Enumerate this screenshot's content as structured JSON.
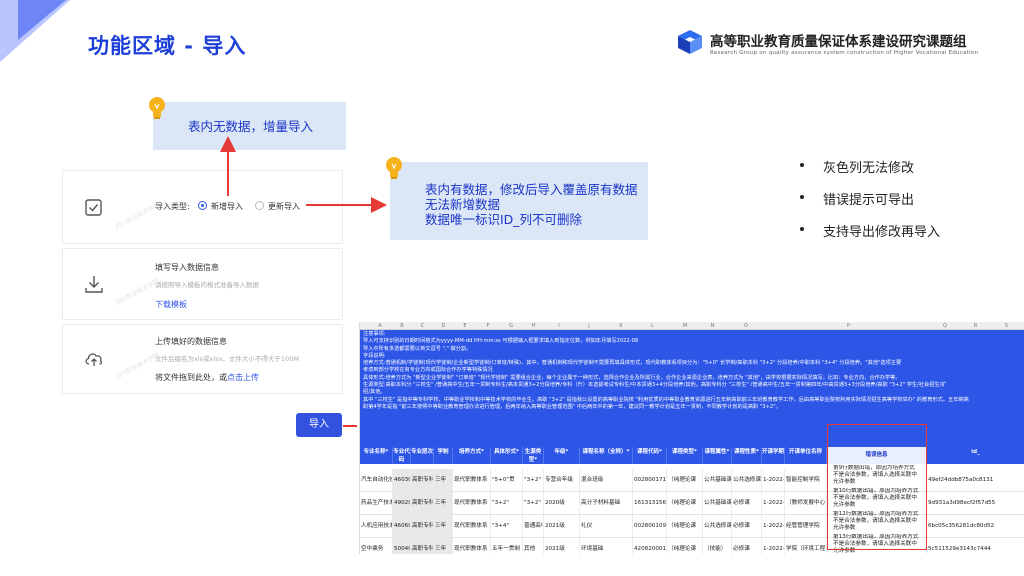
{
  "header": {
    "title": "功能区域 - 导入",
    "org_cn": "高等职业教育质量保证体系建设研究课题组",
    "org_en": "Research Group on quality assurance system construction of Higher Vocational Education"
  },
  "callouts": {
    "c1": "表内无数据，增量导入",
    "c2_lines": [
      "表内有数据，修改后导入覆盖原有数据",
      "无法新增数据",
      "数据唯一标识ID_列不可删除"
    ]
  },
  "panel": {
    "import_type_label": "导入类型:",
    "option_new": "新增导入",
    "option_update": "更新导入",
    "fill_title": "填写导入数据信息",
    "fill_desc": "请按照导入模板的格式准备导入数据",
    "download_link": "下载模板",
    "upload_title": "上传填好的数据信息",
    "upload_desc": "文件后缀名为xls或xlsx，文件大小不得大于100M",
    "drag_text": "将文件拖到此处，或",
    "click_upload": "点击上传",
    "import_button": "导入"
  },
  "watermark": "四川职业技术学院",
  "bullets": [
    "灰色列无法修改",
    "错误提示可导出",
    "支持导出修改再导入"
  ],
  "sheet": {
    "columns": [
      "",
      "A",
      "B",
      "C",
      "D",
      "E",
      "F",
      "G",
      "H",
      "I",
      "J",
      "K",
      "L",
      "M",
      "N",
      "O",
      "P",
      "Q",
      "R",
      "S"
    ],
    "notes": [
      "注意事项:",
      "导入可支持识别的日期时间格式为yyyy-MM-dd HH:mm:ss 可根据输入框要求填入到指定位数，例如年月填写2022-08",
      "导入中所有多选都需要以英文逗号 \",\" 做分割。",
      "字段说明:",
      "培养方式:普通机制/学徒制(现代学徒制/企业新型学徒制/订单班/特殊)，其中，普通机制和现代学徒制不需要再填具体形式，现代职教体系项目分为：\"5+0\" 长学制/高职本科 \"3+2\" 分段培养/中职本科 \"3+4\" 分段培养。\"其他\"选项主要",
      "考虑到部分学校在有专业方向或国际合作办学等特殊情况",
      "具体形式:培养方式为 \"新型企业学徒制\" \"订单班\" \"现代学徒制\" 需要组合企业，每个企业属于一种形式，选择合作企业及所属行业，合作企业来源企业表，培养方式为 \"其他\"，由学校根据实际情况填写，比如：专业方向，合作办学等。",
      "生源类型:高职本科分 \"三校生\" /普通高中生/五年一贯制专科生/高本贯通3+2分段培养/专科（升）本选拔考试专科生/中本贯通3+4分段培养/其他。高职专科分 \"三校生\" /普通高中生/五年一贯制第四年/中高贯通3+3分段培养/高职 \"3+2\" 学生/社会招生/扩",
      "招/其他。",
      "其中 \"三校生\" 是指中等专科学校、中等职业学校和中等技术学校的毕业生。高职 \"3+2\" 是指我公设置的高等职业院校 \"利用优质的中等职业教育资源进行五年制高职前三年的教育教学工作，后由高等职业院校利用实际情况招生高等学校举办\" 的教育形式。五年制高",
      "职第4学年是指 \"前三年按照中等职业教育管理办法进行管理，后两年纳入高等职业管理范围\" 中后两年中的第一年，建议同一教学计划是五年一贯制，不同教学计划的是高职 \"3+2\"。"
    ],
    "headers": [
      "专业名称*",
      "专业代码",
      "专业层次",
      "学制",
      "培养方式*",
      "具体形式*",
      "生源类型*",
      "年级*",
      "课程名称（全称）*",
      "课程代码*",
      "课程类型*",
      "课程属性*",
      "课程性质*",
      "开课学期",
      "开课单位名称",
      "错误信息",
      "id_"
    ],
    "rows": [
      [
        "汽车自动化技",
        "460306",
        "高职专科",
        "三年",
        "现代职教体系",
        "\"5+0\"贯",
        "\"3+2\"",
        "专营合年级",
        "混合班级",
        "002800171",
        "（纯理论课",
        "公共基础课",
        "公共选修课",
        "1-2022-1",
        "智能控制学院",
        "",
        "49ef24ddb875a0c8131"
      ],
      [
        "药品生产技术",
        "490201",
        "高职专科",
        "三年",
        "现代职教体系",
        "\"3+2\"",
        "\"3+2\"",
        "2020级",
        "高分子材料基础",
        "161313156",
        "（纯理论课",
        "公共基础课",
        "必修课",
        "1-2022-1",
        "（教师发展中心",
        "",
        "9d931a3d98ecf2f57d55"
      ],
      [
        "人机应用技术",
        "460609",
        "高职专科",
        "三年",
        "现代职教体系",
        "\"3+4\"",
        "普通高中生",
        "2021级",
        "礼仪",
        "002800109",
        "（纯理论课",
        "公共选修课",
        "必修课",
        "1-2022-1",
        "经管管理学院",
        "",
        "6bc05c356281dc80d52"
      ],
      [
        "空中乘务",
        "500405",
        "高职专科",
        "三年",
        "现代职教体系",
        "五年一贯制",
        "其他",
        "2021级",
        "环境基础",
        "420820001",
        "（纯理论课",
        "（技能）",
        "必修课",
        "1-2022-1",
        "学院（环境工程",
        "",
        "5c511529e3143c7444"
      ]
    ],
    "errors": [
      [
        "第9行数据出错，原因为培养方式",
        "不是合法参数，请填入选择关联中",
        "允许参数"
      ],
      [
        "第10行数据出错，原因为培养方式",
        "不是合法参数，请填入选择关联中",
        "允许参数"
      ],
      [
        "第12行数据出错，原因为培养方式",
        "不是合法参数，请填入选择关联中",
        "允许参数"
      ],
      [
        "第13行数据出错，原因为培养方式",
        "不是合法参数，请填入选择关联中",
        "允许参数"
      ]
    ]
  },
  "colors": {
    "accent": "#2f54eb",
    "title_blue": "#1c3fd8",
    "callout_bg": "#dbe6f6",
    "arrow_red": "#e53935",
    "sheet_blue": "#2d55e6"
  }
}
